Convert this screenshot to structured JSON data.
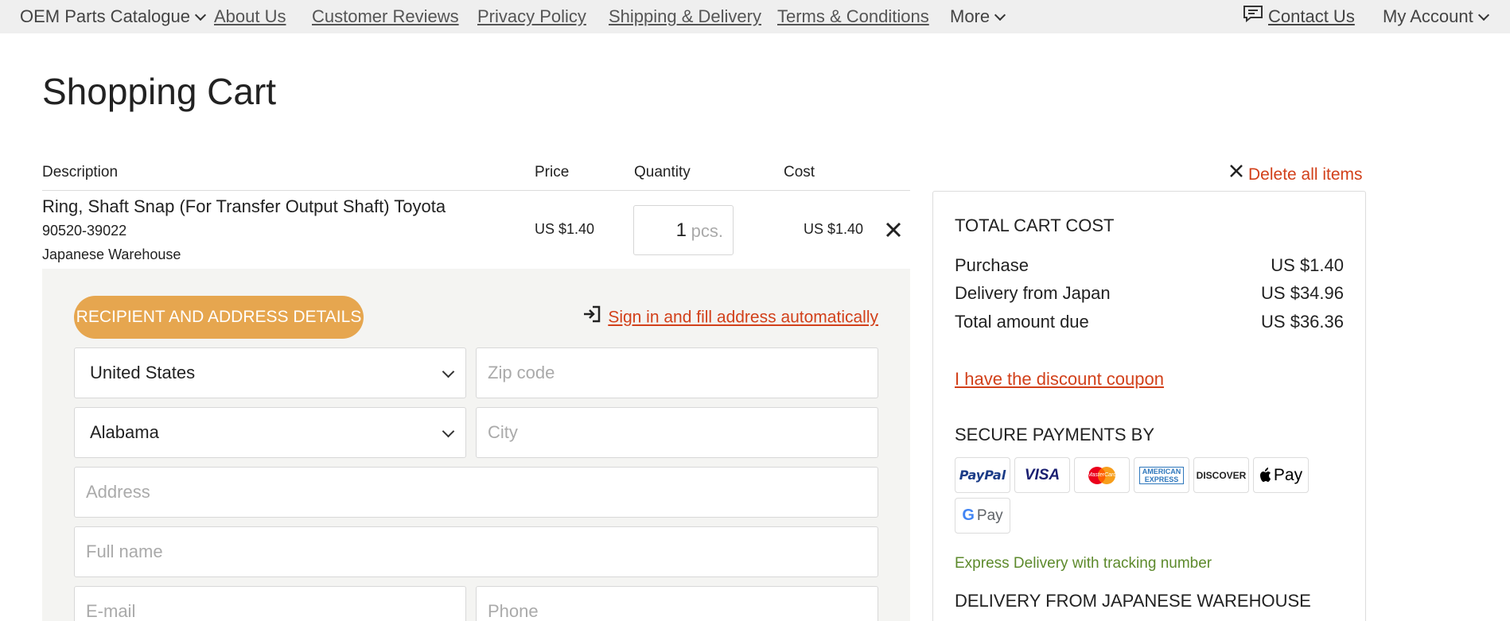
{
  "nav": {
    "catalogue": "OEM Parts Catalogue",
    "about": "About Us",
    "reviews": "Customer Reviews",
    "privacy": "Privacy Policy",
    "shipping": "Shipping & Delivery",
    "terms": "Terms & Conditions",
    "more": "More",
    "contact": "Contact Us",
    "account": "My Account"
  },
  "page_title": "Shopping Cart",
  "table": {
    "headers": {
      "description": "Description",
      "price": "Price",
      "quantity": "Quantity",
      "cost": "Cost"
    },
    "item": {
      "name": "Ring, Shaft Snap (For Transfer Output Shaft) Toyota",
      "sku": "90520-39022",
      "warehouse": "Japanese Warehouse",
      "price": "US $1.40",
      "quantity": "1",
      "unit": "pcs.",
      "cost": "US $1.40"
    }
  },
  "form": {
    "section_button": "RECIPIENT AND ADDRESS DETAILS",
    "signin_link": "Sign in and fill address automatically",
    "country": "United States",
    "state": "Alabama",
    "zip_placeholder": "Zip code",
    "city_placeholder": "City",
    "address_placeholder": "Address",
    "fullname_placeholder": "Full name",
    "email_placeholder": "E-mail",
    "phone_placeholder": "Phone"
  },
  "summary": {
    "delete_all": "Delete all items",
    "title": "TOTAL CART COST",
    "rows": [
      {
        "label": "Purchase",
        "value": "US $1.40"
      },
      {
        "label": "Delivery from Japan",
        "value": "US $34.96"
      },
      {
        "label": "Total amount due",
        "value": "US $36.36"
      }
    ],
    "coupon": "I have the discount coupon",
    "secure_title": "SECURE PAYMENTS BY",
    "payment_methods": [
      "PayPal",
      "VISA",
      "MasterCard",
      "AMERICAN EXPRESS",
      "DISCOVER",
      "Pay",
      "Pay"
    ],
    "express": "Express Delivery with tracking number",
    "delivery_title": "DELIVERY FROM JAPANESE WAREHOUSE"
  },
  "colors": {
    "accent_orange": "#e6a64f",
    "link_red": "#d2401a",
    "express_green": "#5d8a2c",
    "nav_bg": "#efefef",
    "form_bg": "#f4f4f2"
  }
}
